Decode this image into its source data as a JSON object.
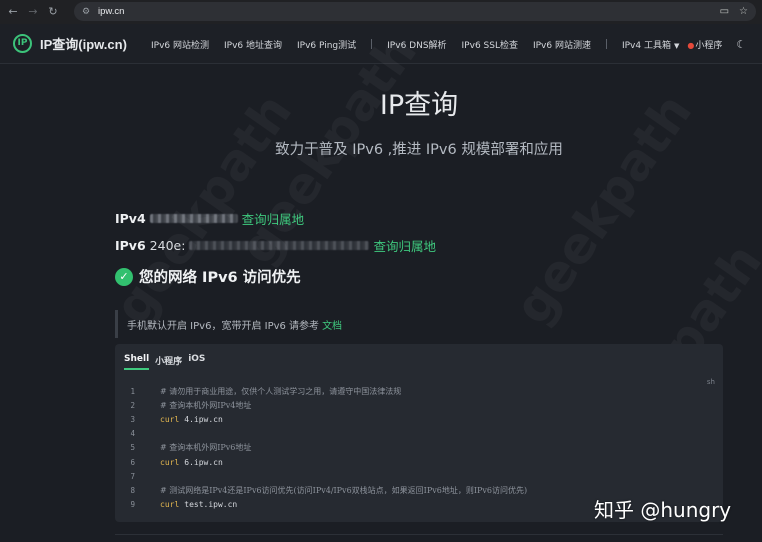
{
  "browser": {
    "url": "ipw.cn",
    "icons": [
      "back-icon",
      "forward-icon",
      "reload-icon",
      "site-info-icon",
      "cast-icon",
      "bookmark-star-icon"
    ]
  },
  "header": {
    "logo_text": "IP",
    "brand": "IP查询(ipw.cn)",
    "nav": [
      "IPv6 网站检测",
      "IPv6 地址查询",
      "IPv6 Ping测试",
      "IPv6 DNS解析",
      "IPv6 SSL检查",
      "IPv6 网站测速"
    ],
    "tools_menu": "IPv4 工具箱",
    "miniprogram": "小程序",
    "theme_icon": "moon-icon"
  },
  "hero": {
    "title": "IP查询",
    "subtitle": "致力于普及 IPv6 ,推进 IPv6 规模部署和应用"
  },
  "ipv4": {
    "label": "IPv4",
    "link": "查询归属地"
  },
  "ipv6": {
    "label": "IPv6",
    "prefix": "240e:",
    "link": "查询归属地"
  },
  "status": {
    "text": "您的网络 IPv6 访问优先",
    "color": "#32c06f"
  },
  "tip": {
    "text": "手机默认开启 IPv6，宽带开启 IPv6 请参考",
    "link": "文档"
  },
  "code_card": {
    "tabs": [
      "Shell",
      "小程序",
      "iOS"
    ],
    "active_tab": "Shell",
    "lang": "sh",
    "lines": [
      {
        "n": "1",
        "comment": "# 请勿用于商业用途，仅供个人测试学习之用，请遵守中国法律法规"
      },
      {
        "n": "2",
        "comment": "# 查询本机外网IPv4地址"
      },
      {
        "n": "3",
        "cmd": "curl",
        "arg": "4.ipw.cn"
      },
      {
        "n": "4"
      },
      {
        "n": "5",
        "comment": "# 查询本机外网IPv6地址"
      },
      {
        "n": "6",
        "cmd": "curl",
        "arg": "6.ipw.cn"
      },
      {
        "n": "7"
      },
      {
        "n": "8",
        "comment": "# 测试网络是IPv4还是IPv6访问优先(访问IPv4/IPv6双栈站点，如果返回IPv6地址，则IPv6访问优先)"
      },
      {
        "n": "9",
        "cmd": "curl",
        "arg": "test.ipw.cn"
      }
    ]
  },
  "watermark": {
    "diagonal": "geekpath",
    "corner": "知乎 @hungry"
  },
  "colors": {
    "accent": "#3fc97e",
    "background": "#1b1e24",
    "card": "#262a31"
  }
}
